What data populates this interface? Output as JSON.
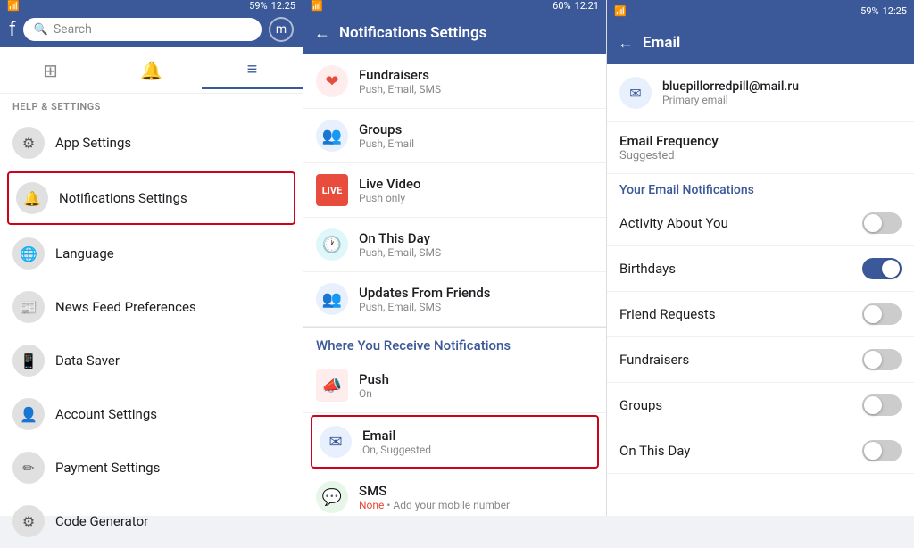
{
  "panel1": {
    "status": {
      "time": "12:25",
      "battery": "59%"
    },
    "search": {
      "placeholder": "Search"
    },
    "nav_tabs": [
      {
        "label": "⊞",
        "icon": "grid-icon",
        "active": false
      },
      {
        "label": "🔔",
        "icon": "bell-icon",
        "active": false
      },
      {
        "label": "≡",
        "icon": "menu-icon",
        "active": true
      }
    ],
    "section_header": "HELP & SETTINGS",
    "menu_items": [
      {
        "id": "app-settings",
        "label": "App Settings",
        "icon": "⚙",
        "selected": false
      },
      {
        "id": "notifications-settings",
        "label": "Notifications Settings",
        "icon": "🔔",
        "selected": true
      },
      {
        "id": "language",
        "label": "Language",
        "icon": "🌐",
        "selected": false
      },
      {
        "id": "news-feed-preferences",
        "label": "News Feed Preferences",
        "icon": "📰",
        "selected": false
      },
      {
        "id": "data-saver",
        "label": "Data Saver",
        "icon": "📱",
        "selected": false
      },
      {
        "id": "account-settings",
        "label": "Account Settings",
        "icon": "👤",
        "selected": false
      },
      {
        "id": "payment-settings",
        "label": "Payment Settings",
        "icon": "✏",
        "selected": false
      },
      {
        "id": "code-generator",
        "label": "Code Generator",
        "icon": "⚙",
        "selected": false
      }
    ]
  },
  "panel2": {
    "status": {
      "time": "12:21",
      "battery": "60%"
    },
    "header": {
      "title": "Notifications Settings",
      "back": "←"
    },
    "notif_items": [
      {
        "id": "fundraisers",
        "label": "Fundraisers",
        "sub": "Push, Email, SMS",
        "icon_type": "red",
        "icon": "❤"
      },
      {
        "id": "groups",
        "label": "Groups",
        "sub": "Push, Email",
        "icon_type": "blue",
        "icon": "👥"
      },
      {
        "id": "live-video",
        "label": "Live Video",
        "sub": "Push only",
        "icon_type": "live",
        "icon": "LIVE"
      },
      {
        "id": "on-this-day",
        "label": "On This Day",
        "sub": "Push, Email, SMS",
        "icon_type": "teal",
        "icon": "🕐"
      },
      {
        "id": "updates-from-friends",
        "label": "Updates From Friends",
        "sub": "Push, Email, SMS",
        "icon_type": "blue",
        "icon": "👥"
      }
    ],
    "where_section": {
      "header": "Where You Receive Notifications",
      "items": [
        {
          "id": "push",
          "label": "Push",
          "sub": "On",
          "icon_type": "push",
          "icon": "📣",
          "selected": false
        },
        {
          "id": "email",
          "label": "Email",
          "sub": "On, Suggested",
          "icon_type": "email",
          "icon": "✉",
          "selected": true
        },
        {
          "id": "sms",
          "label": "SMS",
          "sub_colored": "None",
          "sub_suffix": " • Add your mobile number",
          "icon_type": "sms",
          "icon": "💬",
          "selected": false
        }
      ]
    }
  },
  "panel3": {
    "status": {
      "time": "12:25",
      "battery": "59%"
    },
    "header": {
      "title": "Email",
      "back": "←"
    },
    "email_info": {
      "address": "bluepillorredpill@mail.ru",
      "primary": "Primary email",
      "icon": "✉"
    },
    "frequency": {
      "label": "Email Frequency",
      "value": "Suggested"
    },
    "your_email_notif_header": "Your Email Notifications",
    "toggles": [
      {
        "id": "activity-about-you",
        "label": "Activity About You",
        "on": false
      },
      {
        "id": "birthdays",
        "label": "Birthdays",
        "on": true
      },
      {
        "id": "friend-requests",
        "label": "Friend Requests",
        "on": false
      },
      {
        "id": "fundraisers",
        "label": "Fundraisers",
        "on": false
      },
      {
        "id": "groups",
        "label": "Groups",
        "on": false
      },
      {
        "id": "on-this-day",
        "label": "On This Day",
        "on": false
      }
    ]
  }
}
